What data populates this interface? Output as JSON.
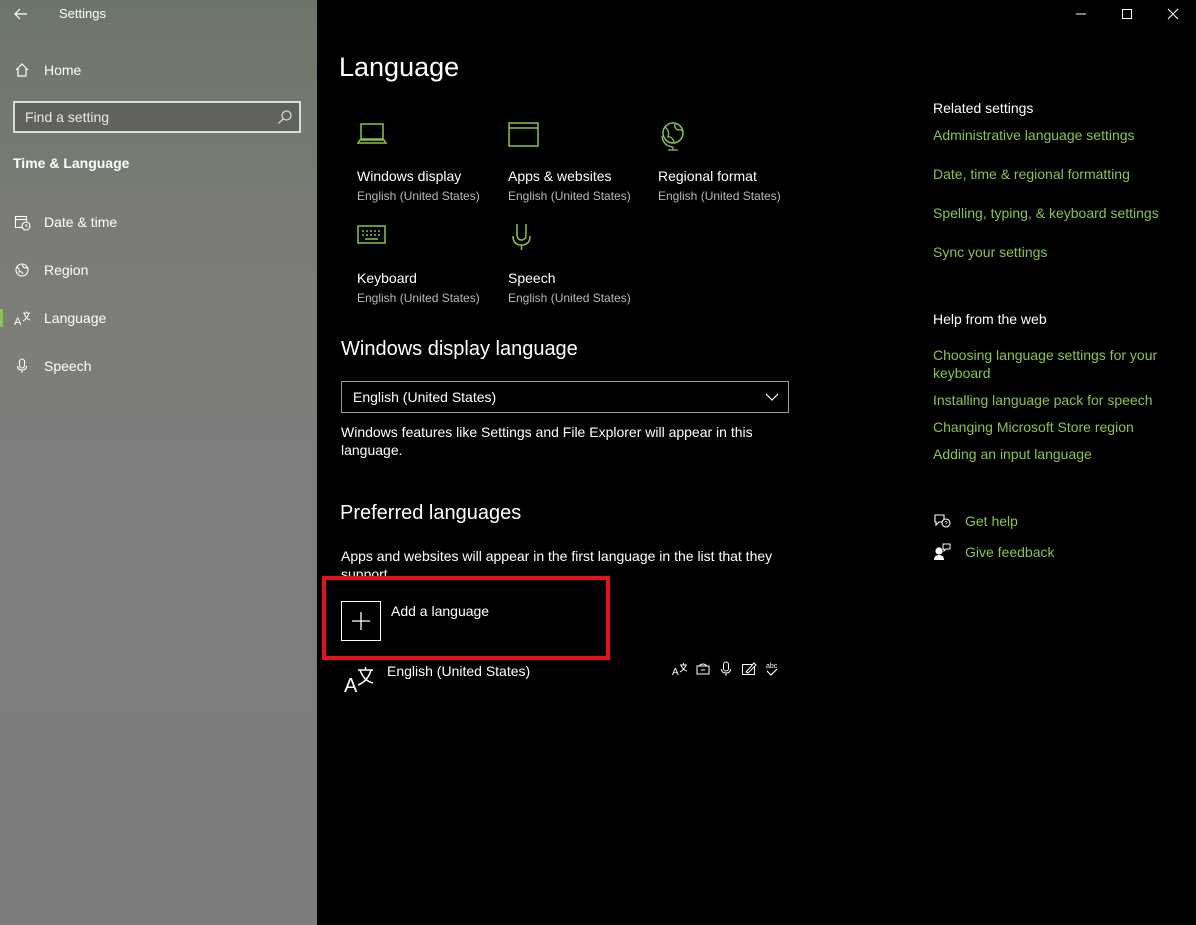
{
  "window": {
    "title": "Settings"
  },
  "sidebar": {
    "home_label": "Home",
    "search_placeholder": "Find a setting",
    "section_title": "Time & Language",
    "items": [
      {
        "label": "Date & time",
        "icon": "calendar-clock-icon"
      },
      {
        "label": "Region",
        "icon": "globe-icon"
      },
      {
        "label": "Language",
        "icon": "language-icon",
        "active": true
      },
      {
        "label": "Speech",
        "icon": "microphone-icon"
      }
    ]
  },
  "main": {
    "title": "Language",
    "tiles": [
      {
        "name": "Windows display",
        "sub": "English (United States)",
        "icon": "laptop-icon"
      },
      {
        "name": "Apps & websites",
        "sub": "English (United States)",
        "icon": "browser-window-icon"
      },
      {
        "name": "Regional format",
        "sub": "English (United States)",
        "icon": "globe-icon"
      },
      {
        "name": "Keyboard",
        "sub": "English (United States)",
        "icon": "keyboard-icon"
      },
      {
        "name": "Speech",
        "sub": "English (United States)",
        "icon": "microphone-icon"
      }
    ],
    "display_language": {
      "heading": "Windows display language",
      "selected": "English (United States)",
      "description": "Windows features like Settings and File Explorer will appear in this language."
    },
    "preferred": {
      "heading": "Preferred languages",
      "description": "Apps and websites will appear in the first language in the list that they support.",
      "add_label": "Add a language",
      "languages": [
        {
          "label": "English (United States)"
        }
      ]
    }
  },
  "right": {
    "related_heading": "Related settings",
    "related_links": [
      "Administrative language settings",
      "Date, time & regional formatting",
      "Spelling, typing, & keyboard settings",
      "Sync your settings"
    ],
    "help_heading": "Help from the web",
    "help_links": [
      "Choosing language settings for your keyboard",
      "Installing language pack for speech",
      "Changing Microsoft Store region",
      "Adding an input language"
    ],
    "get_help": "Get help",
    "give_feedback": "Give feedback"
  },
  "colors": {
    "accent": "#8ac34a",
    "highlight": "#e0131e",
    "background": "#000000"
  }
}
